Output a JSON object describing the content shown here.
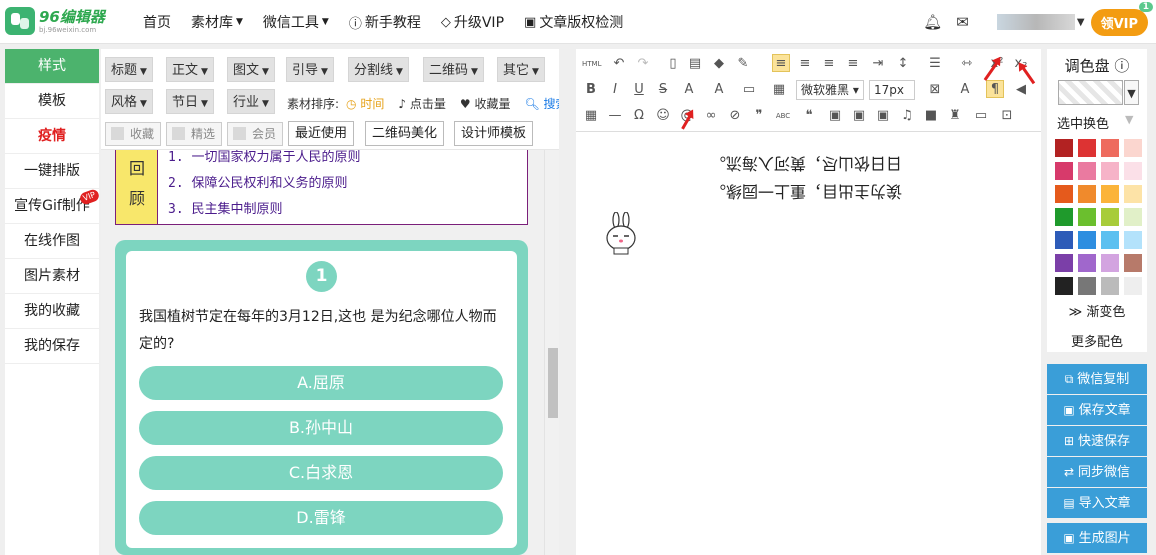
{
  "topbar": {
    "logo_title": "96编辑器",
    "logo_sub": "bj.96weixin.com",
    "nav": [
      {
        "label": "首页",
        "caret": false,
        "icon": ""
      },
      {
        "label": "素材库",
        "caret": true,
        "icon": ""
      },
      {
        "label": "微信工具",
        "caret": true,
        "icon": ""
      },
      {
        "label": "新手教程",
        "caret": false,
        "icon": "?"
      },
      {
        "label": "升级VIP",
        "caret": false,
        "icon": "◇"
      },
      {
        "label": "文章版权检测",
        "caret": false,
        "icon": "▣"
      }
    ],
    "vip_button": "领VIP",
    "vip_badge": "1"
  },
  "leftnav": {
    "items": [
      "样式",
      "模板",
      "疫情",
      "一键排版",
      "宣传Gif制作",
      "在线作图",
      "图片素材",
      "我的收藏",
      "我的保存"
    ],
    "vip_tag": "VIP"
  },
  "filters": {
    "row1": [
      "标题",
      "正文",
      "图文",
      "引导",
      "分割线",
      "二维码",
      "其它"
    ],
    "row2": [
      "风格",
      "节日",
      "行业"
    ],
    "sort_label": "素材排序:",
    "sort_time": "时间",
    "sort_clicks": "点击量",
    "sort_fav": "收藏量",
    "search": "搜索",
    "checks": [
      "收藏",
      "精选",
      "会员"
    ],
    "buttons": [
      "最近使用",
      "二维码美化",
      "设计师模板"
    ]
  },
  "preview": {
    "huigu_chars": [
      "回",
      "顾"
    ],
    "huigu_items": [
      "1. 一切国家权力属于人民的原则",
      "2. 保障公民权利和义务的原则",
      "3. 民主集中制原则"
    ],
    "quiz_number": "1",
    "quiz_question": "我国植树节定在每年的3月12日,这也 是为纪念哪位人物而定的?",
    "quiz_options": [
      "A.屈原",
      "B.孙中山",
      "C.白求恩",
      "D.雷锋"
    ]
  },
  "editor": {
    "html_label": "HTML",
    "font_family": "微软雅黑",
    "font_size": "17px",
    "mirror_lines": [
      "诶为主出目，重上一园缘。",
      "日日依山尽，黄河入海流。"
    ]
  },
  "palette": {
    "title": "调色盘",
    "mode": "选中换色",
    "gradient": "渐变色",
    "more": "更多配色",
    "colors": [
      "#b22222",
      "#dd3333",
      "#ee6b5e",
      "#fbd6cf",
      "#d73a6b",
      "#ea7aa0",
      "#f6b3c8",
      "#fbe0e8",
      "#e55a1c",
      "#f08a2c",
      "#fbb43a",
      "#fde3a7",
      "#1f9a2c",
      "#6bbf2e",
      "#a8cc3a",
      "#e1f0c8",
      "#2d5bb8",
      "#2e8ee0",
      "#5cc0f0",
      "#b3e2fb",
      "#7b3fa8",
      "#a067cc",
      "#d3a4e0",
      "#b77a6a",
      "#222222",
      "#777777",
      "#bbbbbb",
      "#eeeeee"
    ]
  },
  "actions": [
    "微信复制",
    "保存文章",
    "快速保存",
    "同步微信",
    "导入文章",
    "生成图片"
  ]
}
